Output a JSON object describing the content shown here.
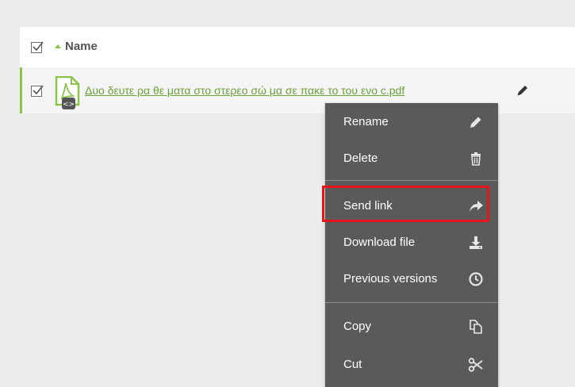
{
  "header": {
    "name_label": "Name"
  },
  "file": {
    "name": "Δυο δευτε ρα θε ματα στο στερεο σώ μα σε πακε το του ενο c.pdf",
    "type_icon": "pdf-file-icon"
  },
  "colors": {
    "accent": "#8bc34a",
    "link": "#6ba13a",
    "menu_bg": "#5a5a5a",
    "highlight": "#e8141c"
  },
  "context_menu": {
    "items": [
      {
        "label": "Rename",
        "icon": "pencil-icon"
      },
      {
        "label": "Delete",
        "icon": "trash-icon"
      },
      {
        "label": "Send link",
        "icon": "share-arrow-icon"
      },
      {
        "label": "Download file",
        "icon": "download-icon"
      },
      {
        "label": "Previous versions",
        "icon": "clock-icon"
      },
      {
        "label": "Copy",
        "icon": "copy-icon"
      },
      {
        "label": "Cut",
        "icon": "scissors-icon"
      }
    ]
  }
}
